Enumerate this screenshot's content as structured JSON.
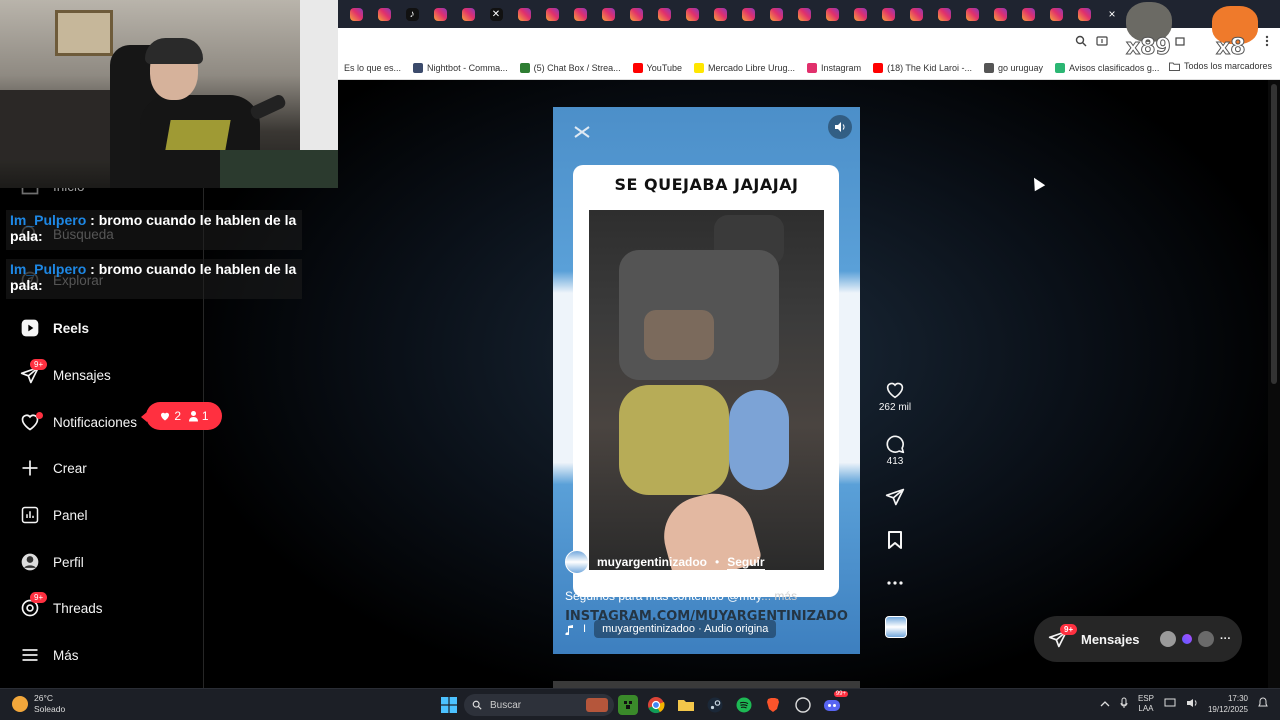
{
  "browser": {
    "tab_icons": [
      "instagram",
      "instagram",
      "tiktok",
      "instagram",
      "instagram",
      "x",
      "instagram",
      "instagram",
      "instagram",
      "instagram",
      "instagram",
      "instagram",
      "instagram",
      "instagram",
      "instagram",
      "instagram",
      "instagram",
      "instagram",
      "instagram",
      "instagram",
      "instagram",
      "instagram",
      "instagram",
      "instagram",
      "instagram",
      "instagram",
      "instagram"
    ],
    "tab_close": "×",
    "bookmarks": [
      {
        "label": "Es lo que es...",
        "icon": "bookmark-icon"
      },
      {
        "label": "Nightbot - Comma...",
        "icon": "nightbot-icon"
      },
      {
        "label": "(5) Chat Box / Strea...",
        "icon": "chatbox-icon"
      },
      {
        "label": "YouTube",
        "icon": "youtube-icon"
      },
      {
        "label": "Mercado Libre Urug...",
        "icon": "mercadolibre-icon"
      },
      {
        "label": "Instagram",
        "icon": "instagram-icon"
      },
      {
        "label": "(18) The Kid Laroi -...",
        "icon": "youtube-icon"
      },
      {
        "label": "go uruguay",
        "icon": "globe-icon"
      },
      {
        "label": "Avisos clasificados g...",
        "icon": "gallito-icon"
      }
    ],
    "all_bookmarks": "Todos los marcadores"
  },
  "stream_overlay": {
    "emote1_count": "x89",
    "emote2_count": "x8",
    "chat": [
      {
        "user": "Im_Pulpero",
        "message": " : bromo cuando le hablen de la pala:"
      },
      {
        "user": "Im_Pulpero",
        "message": " : bromo cuando le hablen de la pala:"
      }
    ]
  },
  "sidebar": {
    "items": [
      {
        "label": "Inicio",
        "icon": "home-icon"
      },
      {
        "label": "Búsqueda",
        "icon": "search-icon"
      },
      {
        "label": "Explorar",
        "icon": "compass-icon"
      },
      {
        "label": "Reels",
        "icon": "reels-icon"
      },
      {
        "label": "Mensajes",
        "icon": "messenger-icon",
        "badge": "9+"
      },
      {
        "label": "Notificaciones",
        "icon": "heart-icon"
      },
      {
        "label": "Crear",
        "icon": "plus-icon"
      },
      {
        "label": "Panel",
        "icon": "chart-icon"
      },
      {
        "label": "Perfil",
        "icon": "avatar-icon"
      },
      {
        "label": "Threads",
        "icon": "threads-icon",
        "badge": "9+"
      },
      {
        "label": "Más",
        "icon": "menu-icon"
      }
    ],
    "notif_pill": {
      "likes": "2",
      "follows": "1"
    }
  },
  "reel": {
    "title": "SE QUEJABA JAJAJAJ",
    "watermark": "INSTAGRAM.COM/MUYARGENTINIZADO",
    "author": "muyargentinizadoo",
    "separator": "•",
    "follow": "Seguir",
    "caption": "Seguinos para más contenido @muy",
    "caption_more": "... más",
    "audio_prefix": "I",
    "audio": "muyargentinizadoo · Audio origina"
  },
  "actions": {
    "likes": "262 mil",
    "comments": "413"
  },
  "messages_pill": {
    "label": "Mensajes",
    "badge": "9+",
    "more": "···"
  },
  "taskbar": {
    "temperature": "26°C",
    "condition": "Soleado",
    "search_placeholder": "Buscar",
    "lang_top": "ESP",
    "lang_bottom": "LAA",
    "time": "17:30",
    "date": "19/12/2025",
    "discord_badge": "99+"
  },
  "colors": {
    "instagram_red": "#ff3040",
    "link_blue": "#1e88e5",
    "reel_blue": "#4c8fc9"
  }
}
